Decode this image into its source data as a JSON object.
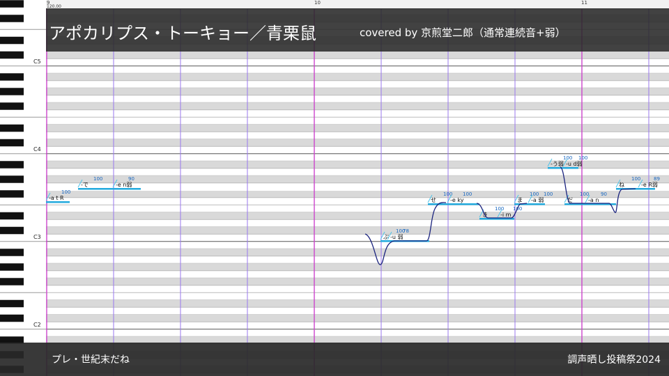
{
  "ruler": {
    "measures": [
      "9",
      "10",
      "11"
    ],
    "tempo": "120.00"
  },
  "title": {
    "main": "アポカリプス・トーキョー／青栗鼠",
    "credit": "covered by 京煎堂二郎（通常連続音+弱）"
  },
  "footer": {
    "left": "プレ・世紀末だね",
    "right": "調声晒し投稿祭2024"
  },
  "keyboard": {
    "octave_labels": [
      "C5",
      "C4",
      "C3",
      "C2"
    ]
  },
  "colors": {
    "note_fill": "#22aadd",
    "note_line": "#4fc3e8",
    "pitch_curve": "#1a237e",
    "lyric": "#1565c0",
    "measure_line": "#cc44cc",
    "beat_line": "#9977ee",
    "row_shade": "#d9d9d9",
    "title_bg": "#2a2a2a"
  },
  "notes": [
    {
      "lyric": "-a t R",
      "velocity": "100"
    },
    {
      "lyric": "-で",
      "velocity": "100"
    },
    {
      "lyric": "-e n弱",
      "velocity": "90"
    },
    {
      "lyric": "ぷ",
      "velocity": "100"
    },
    {
      "lyric": "-u 弱",
      "velocity": "78"
    },
    {
      "lyric": "せ",
      "velocity": "100"
    },
    {
      "lyric": "-e ky",
      "velocity": "100"
    },
    {
      "lyric": "き",
      "velocity": "100"
    },
    {
      "lyric": "-i m",
      "velocity": "100"
    },
    {
      "lyric": "ま",
      "velocity": "100"
    },
    {
      "lyric": "-a 弱",
      "velocity": "100"
    },
    {
      "lyric": "-う弱",
      "velocity": "100"
    },
    {
      "lyric": "-u d弱",
      "velocity": "100"
    },
    {
      "lyric": "だ",
      "velocity": "100"
    },
    {
      "lyric": "-a n",
      "velocity": "90"
    },
    {
      "lyric": "ね",
      "velocity": "100"
    },
    {
      "lyric": "-e R弱",
      "velocity": "89"
    }
  ]
}
